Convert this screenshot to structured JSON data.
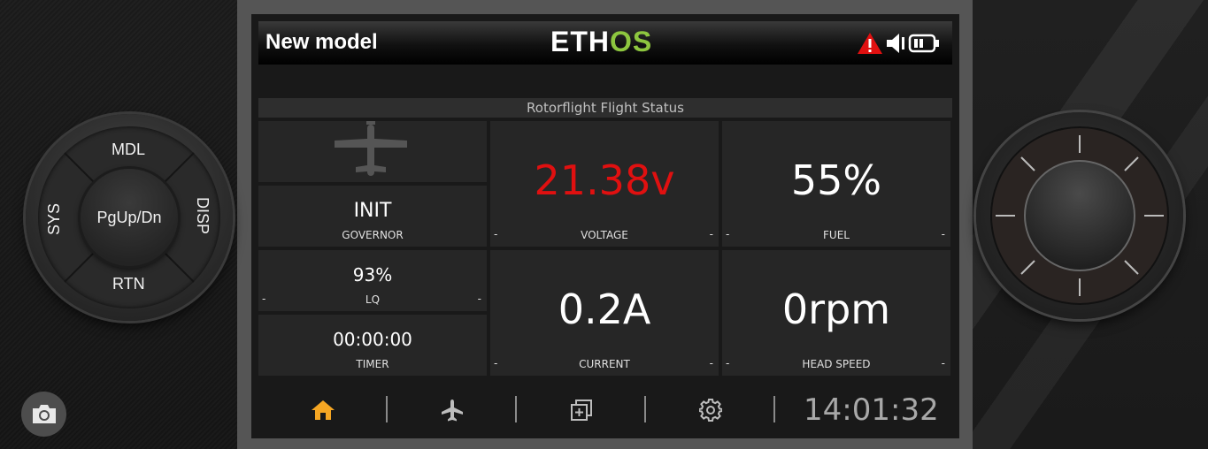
{
  "header": {
    "model_name": "New model",
    "logo_part1": "ETH",
    "logo_part2": "OS",
    "icons": [
      "warning-icon",
      "speaker-icon",
      "battery-icon"
    ]
  },
  "widget": {
    "title": "Rotorflight Flight Status"
  },
  "tiles": {
    "governor": {
      "value": "INIT",
      "label": "GOVERNOR"
    },
    "lq": {
      "value": "93%",
      "label": "LQ",
      "min": "-",
      "max": "-"
    },
    "timer": {
      "value": "00:00:00",
      "label": "TIMER"
    },
    "voltage": {
      "value": "21.38v",
      "label": "VOLTAGE",
      "min": "-",
      "max": "-",
      "color": "#e01010"
    },
    "fuel": {
      "value": "55%",
      "label": "FUEL",
      "min": "-",
      "max": "-"
    },
    "current": {
      "value": "0.2A",
      "label": "CURRENT",
      "min": "-",
      "max": "-"
    },
    "headspeed": {
      "value": "0rpm",
      "label": "HEAD SPEED",
      "min": "-",
      "max": "-"
    }
  },
  "dpad": {
    "up": "MDL",
    "left": "SYS",
    "right": "DISP",
    "down": "RTN",
    "center": "PgUp/Dn"
  },
  "nav": {
    "items": [
      "home-icon",
      "airplane-icon",
      "widgets-icon",
      "settings-icon"
    ],
    "active_color": "#f5a623",
    "clock": "14:01:32"
  },
  "colors": {
    "accent": "#8dc63f",
    "warning": "#e01010"
  }
}
